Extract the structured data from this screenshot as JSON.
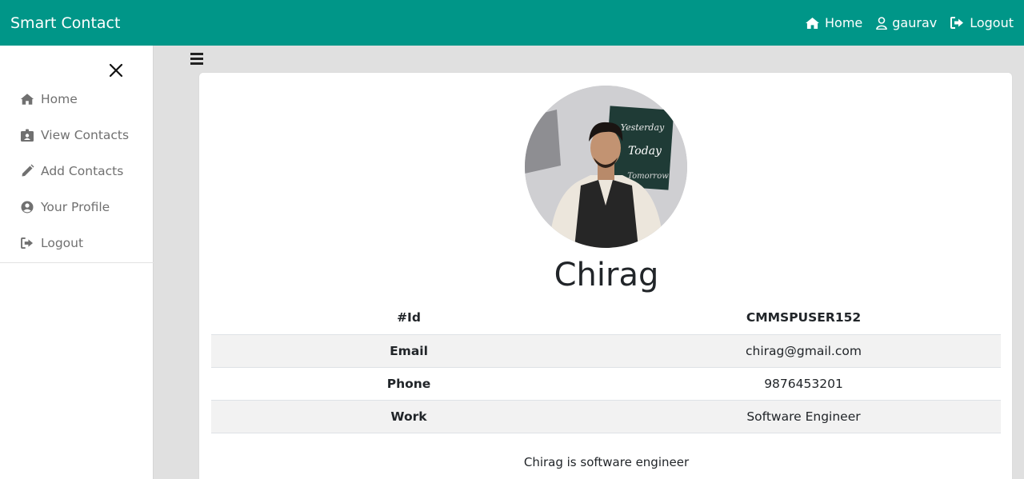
{
  "navbar": {
    "brand": "Smart Contact",
    "links": [
      {
        "label": "Home",
        "icon": "home-icon"
      },
      {
        "label": "gaurav",
        "icon": "user-icon"
      },
      {
        "label": "Logout",
        "icon": "sign-out-icon"
      }
    ],
    "color": "#009688"
  },
  "sidebar": {
    "items": [
      {
        "label": "Home",
        "icon": "home-icon"
      },
      {
        "label": "View Contacts",
        "icon": "id-badge-icon"
      },
      {
        "label": "Add Contacts",
        "icon": "pencil-icon"
      },
      {
        "label": "Your Profile",
        "icon": "user-circle-icon"
      },
      {
        "label": "Logout",
        "icon": "sign-out-icon"
      }
    ]
  },
  "contact": {
    "name": "Chirag",
    "details": [
      {
        "key": "#Id",
        "value": "CMMSPUSER152",
        "value_bold": true
      },
      {
        "key": "Email",
        "value": "chirag@gmail.com",
        "value_bold": false
      },
      {
        "key": "Phone",
        "value": "9876453201",
        "value_bold": false
      },
      {
        "key": "Work",
        "value": "Software Engineer",
        "value_bold": false
      }
    ],
    "description": "Chirag is software engineer",
    "poster_words": [
      "Yesterday",
      "Today",
      "Tomorrow"
    ]
  }
}
